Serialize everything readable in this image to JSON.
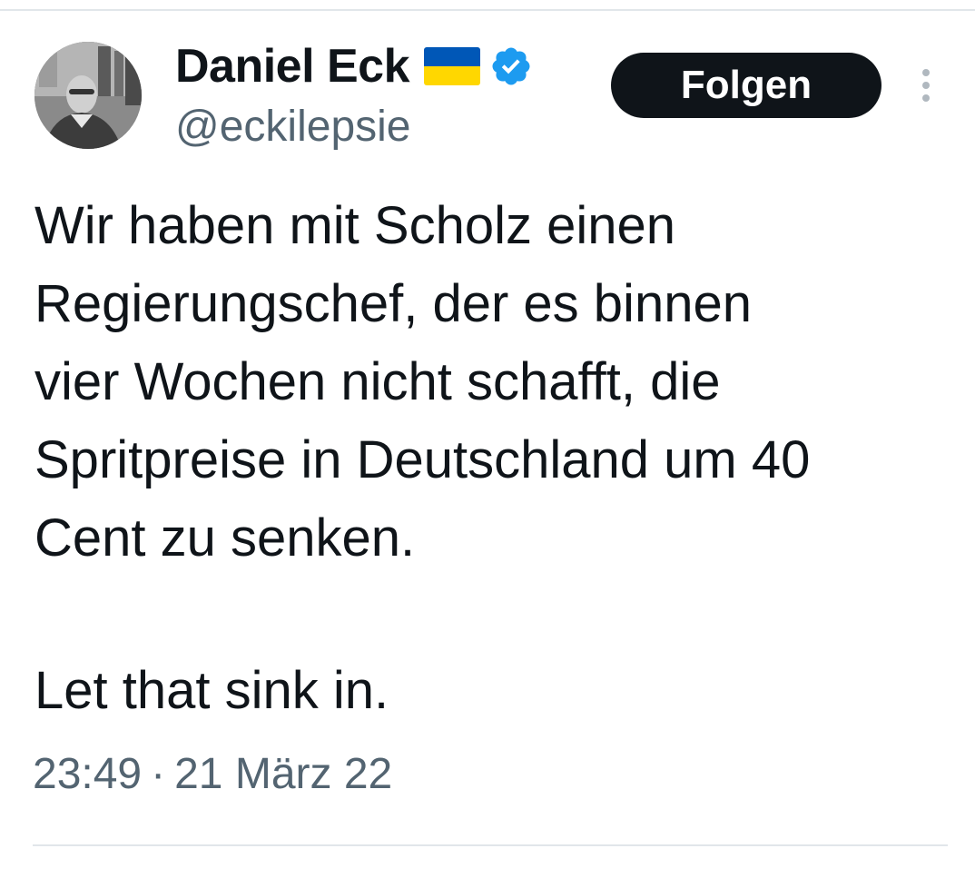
{
  "author": {
    "display_name": "Daniel Eck",
    "handle": "@eckilepsie",
    "flag_icon": "ukraine-flag-icon",
    "verified_icon": "verified-badge-icon",
    "avatar": "avatar-photo"
  },
  "actions": {
    "follow_label": "Folgen",
    "more_icon": "more-options-icon"
  },
  "tweet": {
    "lines": [
      "Wir haben mit Scholz einen",
      "Regierungschef, der es binnen",
      "vier Wochen nicht schafft, die",
      "Spritpreise in Deutschland um 40",
      "Cent zu senken."
    ],
    "closing": "Let that sink in."
  },
  "meta": {
    "time": "23:49",
    "separator": "·",
    "date": "21 März 22"
  },
  "colors": {
    "text": "#0f1419",
    "secondary": "#536471",
    "verified": "#1d9bf0",
    "flag_blue": "#0057b7",
    "flag_yellow": "#ffd700",
    "button_bg": "#0f1419",
    "divider": "#e1e6ea"
  }
}
